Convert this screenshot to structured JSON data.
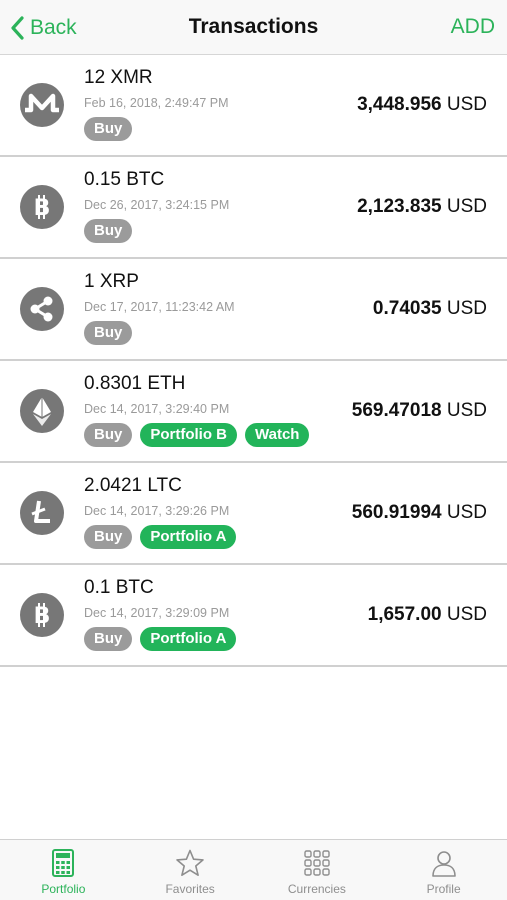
{
  "nav": {
    "back_label": "Back",
    "title": "Transactions",
    "add_label": "ADD"
  },
  "colors": {
    "accent": "#2cb35a",
    "tag_grey": "#9b9b9b",
    "tag_green": "#22b45a",
    "coin_icon_bg": "#777777"
  },
  "transactions": [
    {
      "icon": "monero-icon",
      "amount": "12 XMR",
      "date": "Feb 16, 2018, 2:49:47 PM",
      "value": "3,448.956",
      "currency": "USD",
      "tags": [
        "Buy"
      ]
    },
    {
      "icon": "bitcoin-icon",
      "amount": "0.15 BTC",
      "date": "Dec 26, 2017, 3:24:15 PM",
      "value": "2,123.835",
      "currency": "USD",
      "tags": [
        "Buy"
      ]
    },
    {
      "icon": "ripple-icon",
      "amount": "1 XRP",
      "date": "Dec 17, 2017, 11:23:42 AM",
      "value": "0.74035",
      "currency": "USD",
      "tags": [
        "Buy"
      ]
    },
    {
      "icon": "ethereum-icon",
      "amount": "0.8301 ETH",
      "date": "Dec 14, 2017, 3:29:40 PM",
      "value": "569.47018",
      "currency": "USD",
      "tags": [
        "Buy",
        "Portfolio B",
        "Watch"
      ]
    },
    {
      "icon": "litecoin-icon",
      "amount": "2.0421 LTC",
      "date": "Dec 14, 2017, 3:29:26 PM",
      "value": "560.91994",
      "currency": "USD",
      "tags": [
        "Buy",
        "Portfolio A"
      ]
    },
    {
      "icon": "bitcoin-icon",
      "amount": "0.1 BTC",
      "date": "Dec 14, 2017, 3:29:09 PM",
      "value": "1,657.00",
      "currency": "USD",
      "tags": [
        "Buy",
        "Portfolio A"
      ]
    }
  ],
  "tabbar": {
    "active": "Portfolio",
    "tabs": [
      {
        "label": "Portfolio",
        "icon": "calculator-icon"
      },
      {
        "label": "Favorites",
        "icon": "star-icon"
      },
      {
        "label": "Currencies",
        "icon": "grid-icon"
      },
      {
        "label": "Profile",
        "icon": "person-icon"
      }
    ]
  }
}
